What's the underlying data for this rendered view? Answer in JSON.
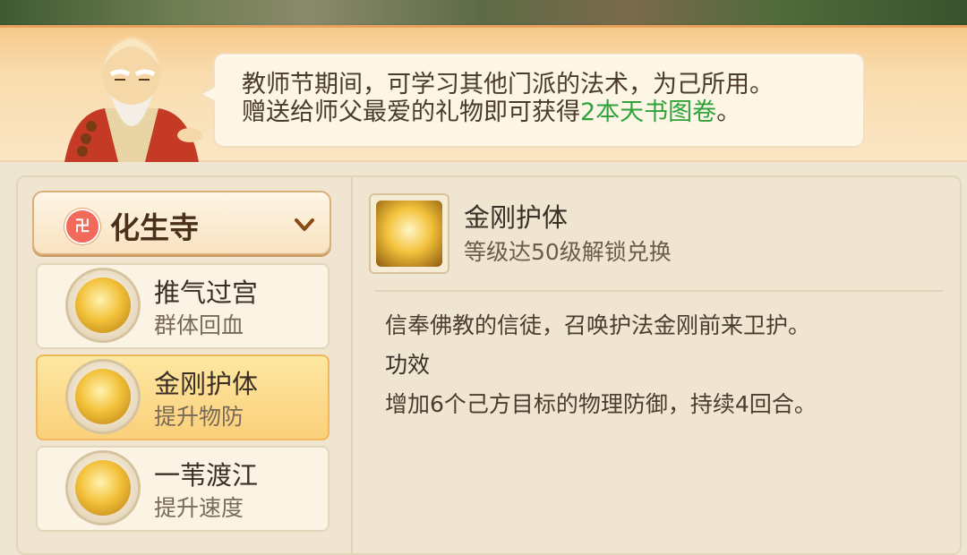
{
  "banner": {
    "line1": "教师节期间，可学习其他门派的法术，为己所用。",
    "line2_prefix": "赠送给师父最爱的礼物即可获得",
    "line2_highlight": "2本天书图卷",
    "line2_suffix": "。"
  },
  "school": {
    "selected": "化生寺",
    "icon": "huasheng-temple-emblem-icon"
  },
  "skills": [
    {
      "name": "推气过宫",
      "sub": "群体回血",
      "icon": "twin-monk-skill-icon"
    },
    {
      "name": "金刚护体",
      "sub": "提升物防",
      "icon": "vajra-guard-skill-icon"
    },
    {
      "name": "一苇渡江",
      "sub": "提升速度",
      "icon": "reed-cross-skill-icon"
    }
  ],
  "detail": {
    "name": "金刚护体",
    "requirement": "等级达50级解锁兑换",
    "description": "信奉佛教的信徒，召唤护法金刚前来卫护。",
    "effect_title": "功效",
    "effect_text": "增加6个己方目标的物理防御，持续4回合。"
  },
  "colors": {
    "highlight": "#2fa33a",
    "active_item": "#fbd07a",
    "banner": "#f9dcae"
  }
}
